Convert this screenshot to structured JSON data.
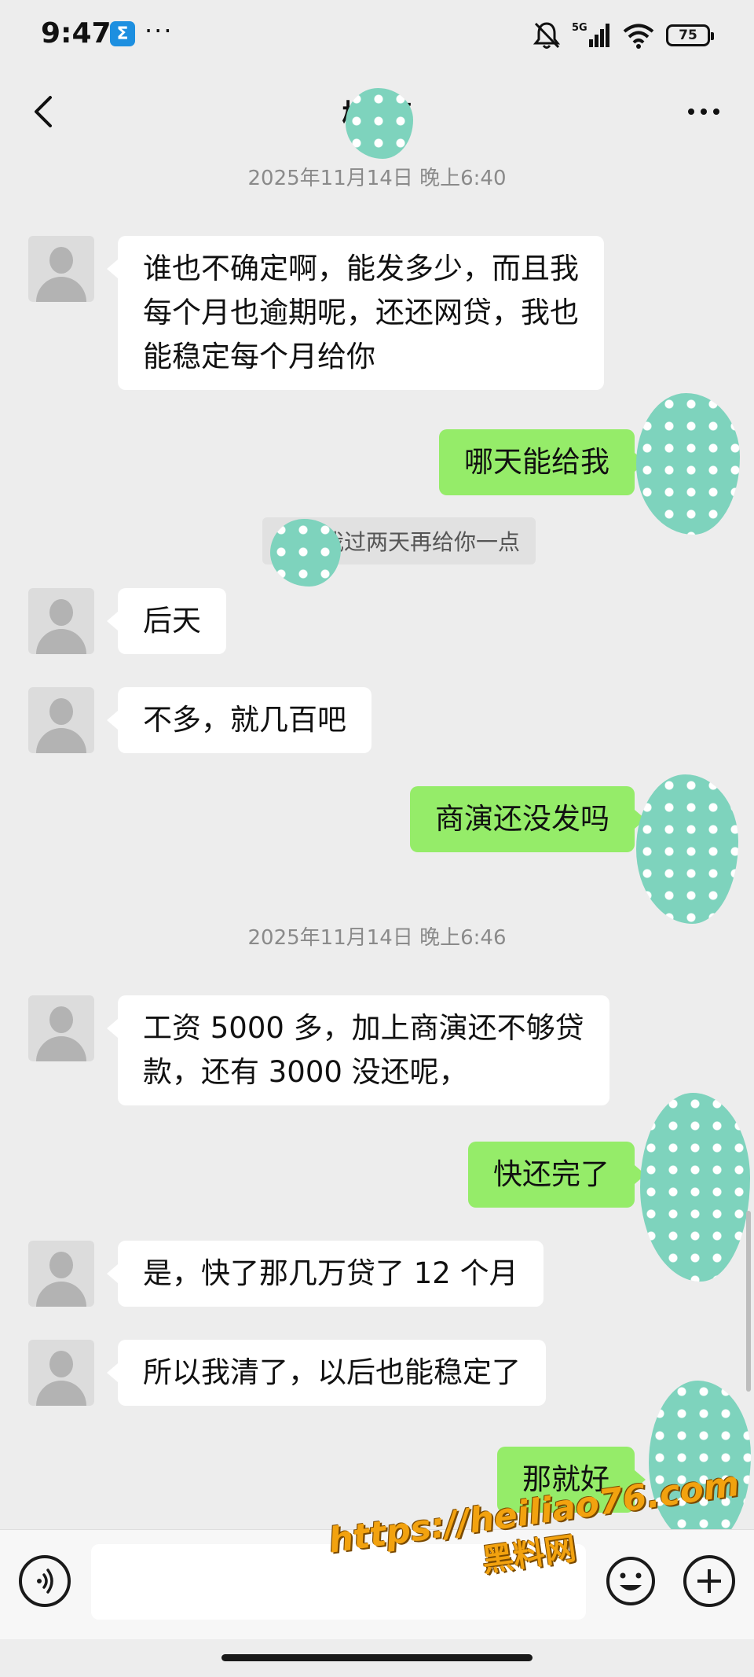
{
  "status_bar": {
    "time": "9:47",
    "app_badge": "Σ",
    "more": "···",
    "signal": "5G",
    "battery": "75"
  },
  "header": {
    "title": "梅  亮"
  },
  "timestamps": [
    "2025年11月14日 晚上6:40",
    "2025年11月14日 晚上6:46"
  ],
  "messages": {
    "m1_line1": "谁也不确定啊，能发多少，而且我",
    "m1_line2": "每个月也逾期呢，还还网贷，我也",
    "m1_line3": "能稳定每个月给你",
    "m2": "哪天能给我",
    "quote": "    亮：我过两天再给你一点",
    "m3": "后天",
    "m4": "不多，就几百吧",
    "m5": "商演还没发吗",
    "m6_line1": "工资 5000 多，加上商演还不够贷",
    "m6_line2": "款，还有 3000 没还呢，",
    "m7": "快还完了",
    "m8": "是，快了那几万贷了 12 个月",
    "m9": "所以我清了，以后也能稳定了",
    "m10": "那就好"
  },
  "input": {
    "placeholder": ""
  },
  "watermark": {
    "url": "https://heiliao76.com",
    "name": "黑料网"
  },
  "colors": {
    "background": "#ededed",
    "outgoing_bubble": "#95ec69",
    "incoming_bubble": "#ffffff",
    "censor_blob": "#7ed3bd"
  }
}
